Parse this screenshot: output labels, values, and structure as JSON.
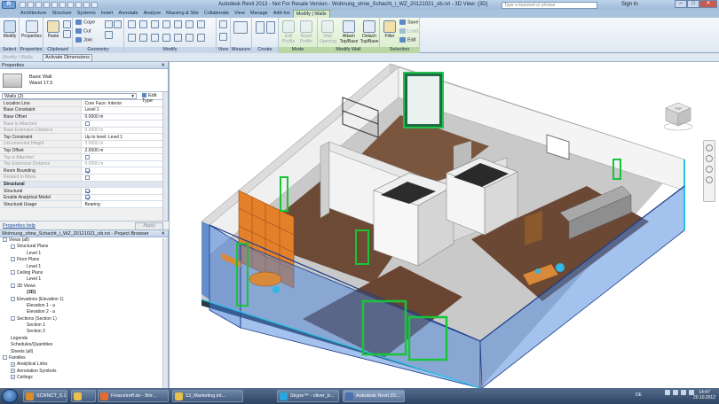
{
  "titlebar": {
    "title": "Autodesk Revit 2013 - Not For Resale Version -   Wohnung_ohne_Schacht_i_WZ_20121021_ob.rvt - 3D View: {3D}",
    "search_placeholder": "Type a keyword or phrase",
    "sign_in": "Sign In",
    "app_button": "R"
  },
  "tabs": [
    "Architecture",
    "Structure",
    "Systems",
    "Insert",
    "Annotate",
    "Analyze",
    "Massing & Site",
    "Collaborate",
    "View",
    "Manage",
    "Add-Ins",
    "Modify | Walls"
  ],
  "ribbon": {
    "groups": {
      "select": "Select",
      "properties": "Properties",
      "clipboard": "Clipboard",
      "geometry": "Geometry",
      "modify": "Modify",
      "view": "View",
      "measure": "Measure",
      "create": "Create",
      "mode": "Mode",
      "modify_wall": "Modify Wall",
      "selection": "Selection"
    },
    "buttons": {
      "modify": "Modify",
      "properties": "Properties",
      "paste": "Paste",
      "cope": "Cope",
      "cut": "Cut",
      "join": "Join",
      "edit_profile": "Edit Profile",
      "reset_profile": "Reset Profile",
      "wall_opening": "Wall Opening",
      "attach": "Attach Top/Base",
      "detach": "Detach Top/Base",
      "filter": "Filter",
      "save": "Save",
      "load": "Load",
      "edit": "Edit"
    }
  },
  "options_bar": {
    "label": "Modify | Walls",
    "activate": "Activate Dimensions"
  },
  "properties": {
    "header": "Properties",
    "type_family": "Basic Wall",
    "type_name": "Wand 17,5",
    "instance": "Walls (2)",
    "edit_type": "Edit Type",
    "rows": [
      {
        "k": "Location Line",
        "v": "Core Face: Interior",
        "dis": false,
        "cb": null
      },
      {
        "k": "Base Constraint",
        "v": "Level 1",
        "dis": false,
        "cb": null
      },
      {
        "k": "Base Offset",
        "v": "0.0000 m",
        "dis": false,
        "cb": null
      },
      {
        "k": "Base is Attached",
        "v": "",
        "dis": true,
        "cb": false
      },
      {
        "k": "Base Extension Distance",
        "v": "0.0000 m",
        "dis": true,
        "cb": null
      },
      {
        "k": "Top Constraint",
        "v": "Up to level: Level 1",
        "dis": false,
        "cb": null
      },
      {
        "k": "Unconnected Height",
        "v": "2.6500 m",
        "dis": true,
        "cb": null
      },
      {
        "k": "Top Offset",
        "v": "2.6500 m",
        "dis": false,
        "cb": null
      },
      {
        "k": "Top is Attached",
        "v": "",
        "dis": true,
        "cb": false
      },
      {
        "k": "Top Extension Distance",
        "v": "0.0000 m",
        "dis": true,
        "cb": null
      },
      {
        "k": "Room Bounding",
        "v": "",
        "dis": false,
        "cb": true
      },
      {
        "k": "Related to Mass",
        "v": "",
        "dis": true,
        "cb": false
      },
      {
        "k": "Structural",
        "v": "",
        "dis": false,
        "cb": null,
        "section": true
      },
      {
        "k": "Structural",
        "v": "",
        "dis": false,
        "cb": true
      },
      {
        "k": "Enable Analytical Model",
        "v": "",
        "dis": false,
        "cb": true
      },
      {
        "k": "Structural Usage",
        "v": "Bearing",
        "dis": false,
        "cb": null
      }
    ],
    "help": "Properties help",
    "apply": "Apply"
  },
  "browser": {
    "header": "Wohnung_ohne_Schacht_i_WZ_20121021_ob.rvt - Project Browser",
    "items": [
      {
        "t": "Views (all)",
        "lvl": 0,
        "tg": "-"
      },
      {
        "t": "Structural Plans",
        "lvl": 1,
        "tg": "-"
      },
      {
        "t": "Level 1",
        "lvl": 2,
        "tg": ""
      },
      {
        "t": "Floor Plans",
        "lvl": 1,
        "tg": "-"
      },
      {
        "t": "Level 1",
        "lvl": 2,
        "tg": ""
      },
      {
        "t": "Ceiling Plans",
        "lvl": 1,
        "tg": "-"
      },
      {
        "t": "Level 1",
        "lvl": 2,
        "tg": ""
      },
      {
        "t": "3D Views",
        "lvl": 1,
        "tg": "-"
      },
      {
        "t": "{3D}",
        "lvl": 2,
        "tg": "",
        "bold": true
      },
      {
        "t": "Elevations (Elevation 1)",
        "lvl": 1,
        "tg": "-"
      },
      {
        "t": "Elevation 1 - a",
        "lvl": 2,
        "tg": ""
      },
      {
        "t": "Elevation 2 - a",
        "lvl": 2,
        "tg": ""
      },
      {
        "t": "Sections (Section 1)",
        "lvl": 1,
        "tg": "-"
      },
      {
        "t": "Section 1",
        "lvl": 2,
        "tg": ""
      },
      {
        "t": "Section 2",
        "lvl": 2,
        "tg": ""
      },
      {
        "t": "Legends",
        "lvl": 0,
        "tg": ""
      },
      {
        "t": "Schedules/Quantities",
        "lvl": 0,
        "tg": ""
      },
      {
        "t": "Sheets (all)",
        "lvl": 0,
        "tg": ""
      },
      {
        "t": "Families",
        "lvl": 0,
        "tg": "-"
      },
      {
        "t": "Analytical Links",
        "lvl": 1,
        "tg": "+"
      },
      {
        "t": "Annotation Symbols",
        "lvl": 1,
        "tg": "+"
      },
      {
        "t": "Ceilings",
        "lvl": 1,
        "tg": "+"
      }
    ]
  },
  "viewcube": {
    "label": "TOP"
  },
  "taskbar": {
    "items": [
      {
        "label": "SCRNCT_5.1",
        "color": "#d98c2b"
      },
      {
        "label": "",
        "color": "#e8c04a"
      },
      {
        "label": "Finanztreff.de - Bör...",
        "color": "#e56a2d"
      },
      {
        "label": "13_Marketing.int...",
        "color": "#e8c04a"
      },
      {
        "label": "Skype™ - oliver_b...",
        "color": "#2aa6e0"
      },
      {
        "label": "Autodesk Revit 20...",
        "color": "#4b6fb0"
      }
    ],
    "lang": "DE",
    "time": "14:47",
    "date": "20.10.2012"
  }
}
